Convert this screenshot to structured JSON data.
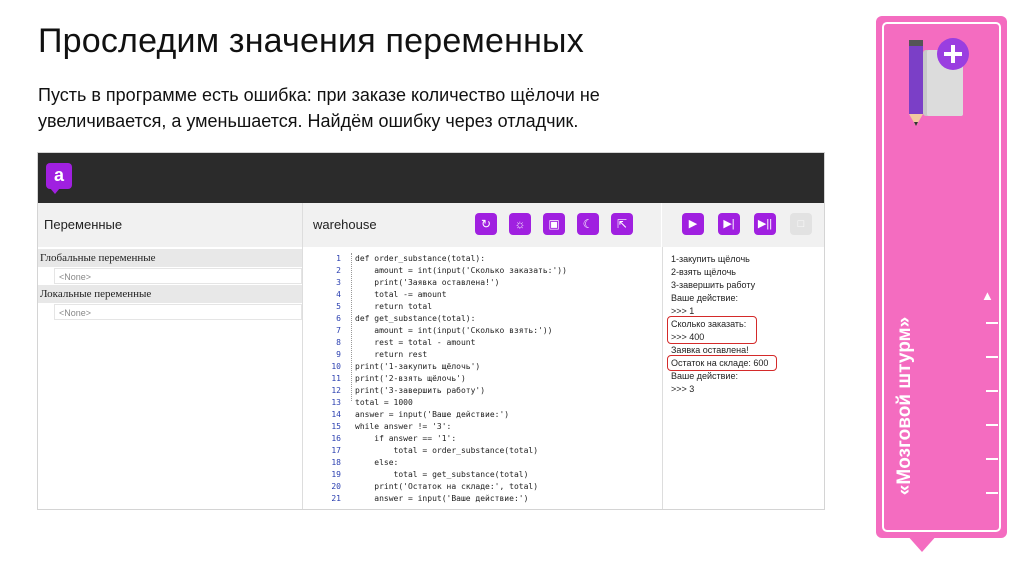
{
  "slide": {
    "title": "Проследим значения переменных",
    "subtitle": "Пусть в программе есть ошибка: при заказе количество щёлочи не увеличивается, а уменьшается. Найдём ошибку через отладчик."
  },
  "app": {
    "logo_letter": "a",
    "variables_title": "Переменные",
    "global_label": "Глобальные переменные",
    "local_label": "Локальные переменные",
    "none_value": "<None>",
    "file_name": "warehouse",
    "code_lines": [
      {
        "n": "1",
        "text": "def order_substance(total):"
      },
      {
        "n": "2",
        "text": "    amount = int(input('Сколько заказать:'))"
      },
      {
        "n": "3",
        "text": "    print('Заявка оставлена!')"
      },
      {
        "n": "4",
        "text": "    total -= amount"
      },
      {
        "n": "5",
        "text": "    return total"
      },
      {
        "n": "6",
        "text": "def get_substance(total):"
      },
      {
        "n": "7",
        "text": "    amount = int(input('Сколько взять:'))"
      },
      {
        "n": "8",
        "text": "    rest = total - amount"
      },
      {
        "n": "9",
        "text": "    return rest"
      },
      {
        "n": "10",
        "text": "print('1-закупить щёлочь')"
      },
      {
        "n": "11",
        "text": "print('2-взять щёлочь')"
      },
      {
        "n": "12",
        "text": "print('3-завершить работу')"
      },
      {
        "n": "13",
        "text": "total = 1000"
      },
      {
        "n": "14",
        "text": "answer = input('Ваше действие:')"
      },
      {
        "n": "15",
        "text": "while answer != '3':"
      },
      {
        "n": "16",
        "text": "    if answer == '1':"
      },
      {
        "n": "17",
        "text": "        total = order_substance(total)"
      },
      {
        "n": "18",
        "text": "    else:"
      },
      {
        "n": "19",
        "text": "        total = get_substance(total)"
      },
      {
        "n": "20",
        "text": "    print('Остаток на складе:', total)"
      },
      {
        "n": "21",
        "text": "    answer = input('Ваше действие:')"
      }
    ],
    "console_lines": [
      "1-закупить щёлочь",
      "2-взять щёлочь",
      "3-завершить работу",
      "Ваше действие:",
      ">>> 1",
      "Сколько заказать:",
      ">>> 400",
      "Заявка оставлена!",
      "Остаток на складе: 600",
      "Ваше действие:",
      ">>> 3"
    ],
    "toolbar_icons": [
      "refresh-icon",
      "debug-icon",
      "save-icon",
      "theme-icon",
      "fullscreen-icon"
    ],
    "run_icons": [
      "run-icon",
      "step-icon",
      "step-over-icon",
      "stop-icon"
    ]
  },
  "side": {
    "label": "«Мозговой штурм»"
  },
  "colors": {
    "accent": "#a020e0",
    "side": "#f46cc0",
    "highlight": "#d42a2a"
  }
}
